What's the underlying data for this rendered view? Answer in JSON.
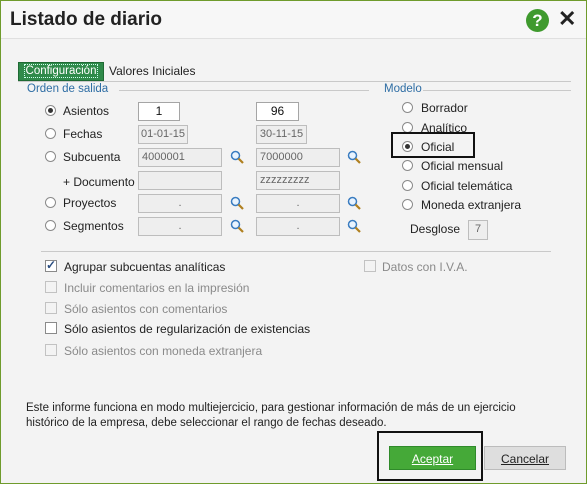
{
  "window": {
    "title": "Listado de diario",
    "help": "?",
    "close": "✕"
  },
  "tabs": [
    {
      "label": "Configuración",
      "active": true
    },
    {
      "label": "Valores Iniciales",
      "active": false
    }
  ],
  "orden": {
    "label": "Orden de salida",
    "rows": [
      {
        "label": "Asientos",
        "checked": true,
        "from": "1",
        "to": "96",
        "enabled": true,
        "search": false
      },
      {
        "label": "Fechas",
        "checked": false,
        "from": "01-01-15",
        "to": "30-11-15",
        "enabled": false,
        "search": false
      },
      {
        "label": "Subcuenta",
        "checked": false,
        "from": "4000001",
        "to": "7000000",
        "enabled": false,
        "search": true
      },
      {
        "label": "+ Documento",
        "checked": null,
        "from": "",
        "to": "zzzzzzzzz",
        "enabled": false,
        "search": false
      },
      {
        "label": "Proyectos",
        "checked": false,
        "from": ".",
        "to": ".",
        "enabled": false,
        "search": true
      },
      {
        "label": "Segmentos",
        "checked": false,
        "from": ".",
        "to": ".",
        "enabled": false,
        "search": true
      }
    ]
  },
  "modelo": {
    "label": "Modelo",
    "options": [
      {
        "label": "Borrador",
        "checked": false,
        "enabled": true
      },
      {
        "label": "Analítico",
        "checked": false,
        "enabled": true
      },
      {
        "label": "Oficial",
        "checked": true,
        "enabled": true
      },
      {
        "label": "Oficial mensual",
        "checked": false,
        "enabled": true
      },
      {
        "label": "Oficial telemática",
        "checked": false,
        "enabled": true
      },
      {
        "label": "Moneda extranjera",
        "checked": false,
        "enabled": true
      }
    ],
    "desglose_label": "Desglose",
    "desglose_value": "7"
  },
  "checks": [
    {
      "label": "Agrupar subcuentas analíticas",
      "checked": true,
      "enabled": true
    },
    {
      "label": "Incluir comentarios en la impresión",
      "checked": false,
      "enabled": false
    },
    {
      "label": "Sólo asientos con comentarios",
      "checked": false,
      "enabled": false
    },
    {
      "label": "Sólo asientos de regularización de existencias",
      "checked": false,
      "enabled": true
    },
    {
      "label": "Sólo asientos con moneda extranjera",
      "checked": false,
      "enabled": false
    }
  ],
  "datos_iva": {
    "label": "Datos con I.V.A.",
    "checked": false,
    "enabled": false
  },
  "info_text": "Este informe funciona en modo multiejercicio, para gestionar información de más de un ejercicio histórico de la empresa, debe seleccionar el rango de fechas deseado.",
  "buttons": {
    "accept": "Aceptar",
    "cancel": "Cancelar"
  },
  "colors": {
    "accent": "#45a938",
    "tab_active": "#2f8a4a",
    "group_label": "#2e6da4"
  }
}
